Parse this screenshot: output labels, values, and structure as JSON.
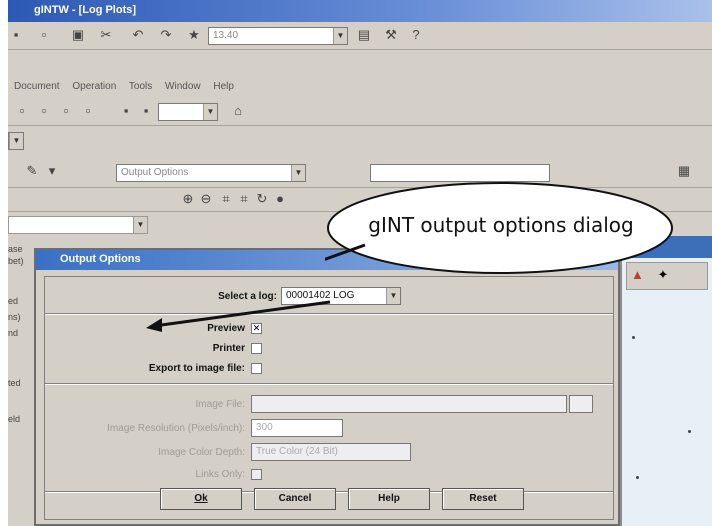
{
  "window": {
    "title": "gINTW - [Log Plots]"
  },
  "toolbar": {
    "zoom_value": "13.40"
  },
  "menubar": {
    "items": [
      "Document",
      "Operation",
      "Tools",
      "Window",
      "Help"
    ]
  },
  "toolbar3": {
    "combo_value": "Output Options",
    "combo2_value": ""
  },
  "dialog": {
    "title": "Output Options",
    "select_log_label": "Select a log:",
    "select_log_value": "00001402 LOG",
    "preview_label": "Preview",
    "preview_checked": "✕",
    "printer_label": "Printer",
    "export_label": "Export to image file:",
    "image_file_label": "Image File:",
    "image_resolution_label": "Image Resolution (Pixels/inch):",
    "image_resolution_value": "300",
    "image_color_depth_label": "Image Color Depth:",
    "image_color_depth_value": "True Color (24 Bit)",
    "links_only_label": "Links Only:",
    "ok_label": "Ok",
    "cancel_label": "Cancel",
    "help_label": "Help",
    "reset_label": "Reset"
  },
  "callout": {
    "text": "gINT output options dialog"
  },
  "side_labels": [
    "ase",
    "bet)",
    "ed",
    "ns)",
    "nd",
    "ted",
    "eld"
  ],
  "colors": {
    "title_blue": "#2b59b5",
    "dialog_face": "#d4d0c8",
    "panel_bg": "#e7f0f7"
  }
}
